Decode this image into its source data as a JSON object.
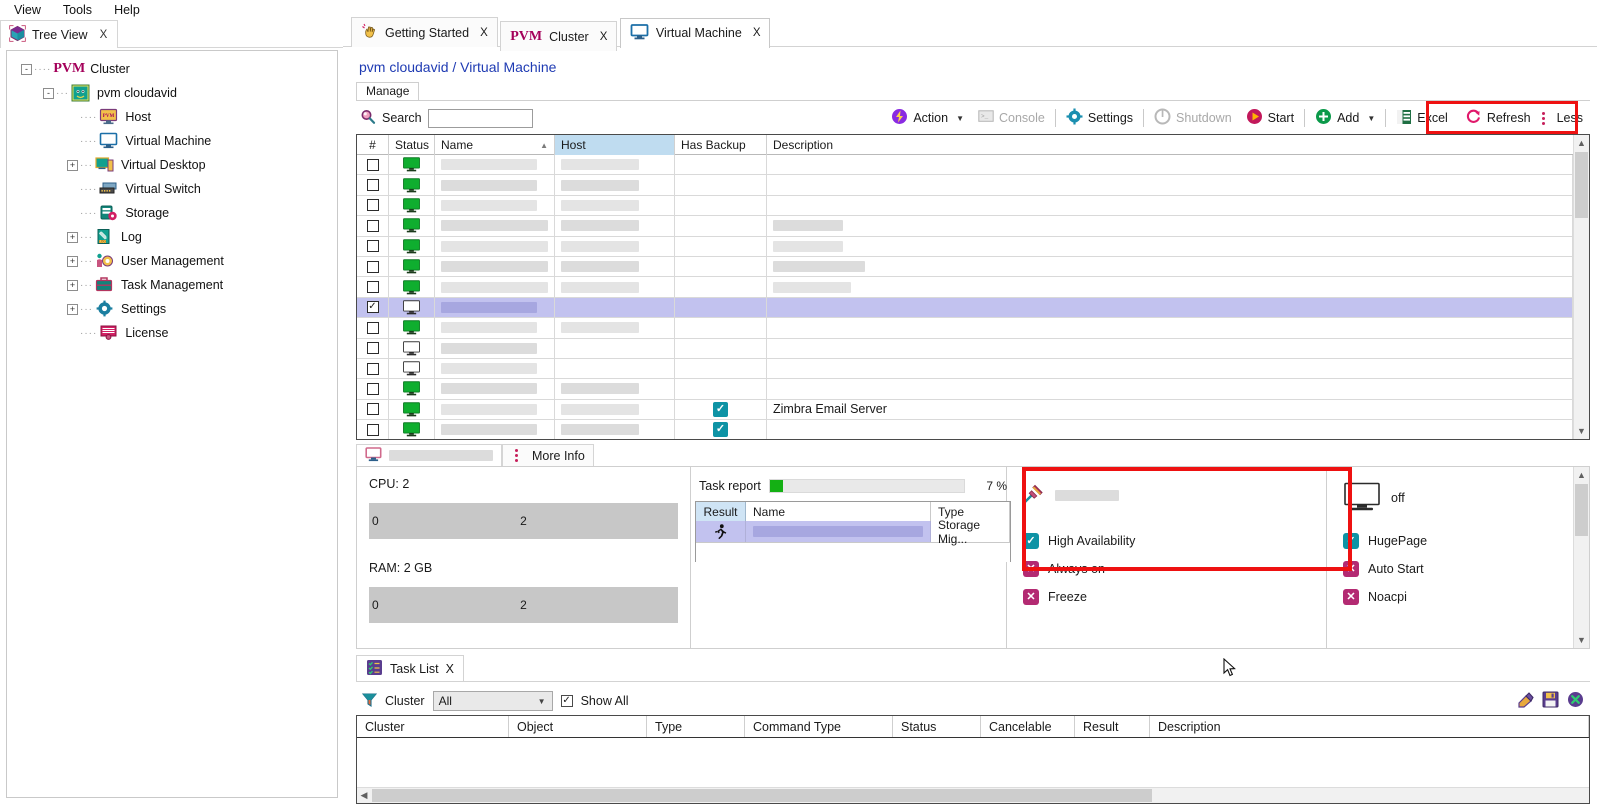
{
  "menubar": {
    "items": [
      "View",
      "Tools",
      "Help"
    ]
  },
  "left_tab": {
    "label": "Tree View",
    "close": "X",
    "icon": "cube-icon"
  },
  "tree": {
    "root": {
      "label": "Cluster",
      "brand": "PVM",
      "expander": "-"
    },
    "node": {
      "label": "pvm cloudavid",
      "expander": "-",
      "icon": "tiger-icon"
    },
    "children": [
      {
        "label": "Host",
        "expander": "none",
        "icon": "host-monitor-icon"
      },
      {
        "label": "Virtual Machine",
        "expander": "none",
        "icon": "monitor-icon"
      },
      {
        "label": "Virtual Desktop",
        "expander": "+",
        "icon": "desktop-icon"
      },
      {
        "label": "Virtual Switch",
        "expander": "none",
        "icon": "switch-icon"
      },
      {
        "label": "Storage",
        "expander": "none",
        "icon": "storage-icon"
      },
      {
        "label": "Log",
        "expander": "+",
        "icon": "log-icon"
      },
      {
        "label": "User Management",
        "expander": "+",
        "icon": "user-gear-icon"
      },
      {
        "label": "Task Management",
        "expander": "+",
        "icon": "briefcase-icon"
      },
      {
        "label": "Settings",
        "expander": "+",
        "icon": "gear-icon"
      },
      {
        "label": "License",
        "expander": "none",
        "icon": "license-icon"
      }
    ]
  },
  "top_tabs": [
    {
      "label": "Getting Started",
      "close": "X",
      "icon": "hand-wave-icon",
      "active": false
    },
    {
      "label": "Cluster",
      "close": "X",
      "icon": "pvm-logo-icon",
      "active": false
    },
    {
      "label": "Virtual Machine",
      "close": "X",
      "icon": "monitor-icon",
      "active": true
    }
  ],
  "breadcrumb": "pvm cloudavid / Virtual Machine",
  "manage_tab": "Manage",
  "search": {
    "label": "Search",
    "value": "",
    "placeholder": "",
    "icon": "search-icon"
  },
  "toolbar": {
    "buttons": [
      {
        "label": "Action",
        "icon": "action-icon",
        "caret": "▼",
        "disabled": false
      },
      {
        "label": "Console",
        "icon": "console-icon",
        "caret": "",
        "disabled": true
      },
      {
        "label": "Settings",
        "icon": "gear-icon",
        "caret": "",
        "disabled": false
      },
      {
        "label": "Shutdown",
        "icon": "power-icon",
        "caret": "",
        "disabled": true
      },
      {
        "label": "Start",
        "icon": "play-icon",
        "caret": "",
        "disabled": false
      },
      {
        "label": "Add",
        "icon": "plus-icon",
        "caret": "▼",
        "disabled": false
      },
      {
        "label": "Excel",
        "icon": "excel-icon",
        "caret": "",
        "disabled": false
      },
      {
        "label": "Refresh",
        "icon": "refresh-icon",
        "caret": "",
        "disabled": false
      },
      {
        "label": "Less",
        "icon": "vertical-dots-icon",
        "caret": "",
        "disabled": false
      }
    ],
    "highlight_color": "#ee1111"
  },
  "vm_grid": {
    "columns": [
      "#",
      "Status",
      "Name",
      "Host",
      "Has Backup",
      "Description"
    ],
    "sorted_column": "Name",
    "sort_direction": "asc",
    "selected_column": "Host",
    "rows": [
      {
        "checked": false,
        "status": "on",
        "name": "",
        "host": "",
        "has_backup": false,
        "description": ""
      },
      {
        "checked": false,
        "status": "on",
        "name": "",
        "host": "",
        "has_backup": false,
        "description": ""
      },
      {
        "checked": false,
        "status": "on",
        "name": "",
        "host": "",
        "has_backup": false,
        "description": ""
      },
      {
        "checked": false,
        "status": "on",
        "name": "",
        "host": "",
        "has_backup": false,
        "description": ""
      },
      {
        "checked": false,
        "status": "on",
        "name": "",
        "host": "",
        "has_backup": false,
        "description": ""
      },
      {
        "checked": false,
        "status": "on",
        "name": "",
        "host": "",
        "has_backup": false,
        "description": ""
      },
      {
        "checked": false,
        "status": "on",
        "name": "",
        "host": "",
        "has_backup": false,
        "description": ""
      },
      {
        "checked": true,
        "status": "off",
        "name": "",
        "host": "",
        "has_backup": false,
        "description": "",
        "selected": true
      },
      {
        "checked": false,
        "status": "on",
        "name": "",
        "host": "",
        "has_backup": false,
        "description": ""
      },
      {
        "checked": false,
        "status": "off",
        "name": "",
        "host": "",
        "has_backup": false,
        "description": ""
      },
      {
        "checked": false,
        "status": "off",
        "name": "",
        "host": "",
        "has_backup": false,
        "description": ""
      },
      {
        "checked": false,
        "status": "on",
        "name": "",
        "host": "",
        "has_backup": false,
        "description": ""
      },
      {
        "checked": false,
        "status": "on",
        "name": "",
        "host": "",
        "has_backup": true,
        "description": "Zimbra Email Server"
      },
      {
        "checked": false,
        "status": "on",
        "name": "",
        "host": "",
        "has_backup": true,
        "description": ""
      }
    ]
  },
  "details": {
    "tab_name": "",
    "more_info_label": "More Info",
    "cpu": {
      "label": "CPU: 2",
      "min": "0",
      "value": "2"
    },
    "ram": {
      "label": "RAM: 2 GB",
      "min": "0",
      "value": "2"
    },
    "task_report": {
      "label": "Task report",
      "percent_label": "7 %",
      "percent": 7,
      "columns": [
        "Result",
        "Name",
        "Type"
      ],
      "rows": [
        {
          "result_icon": "running-person-icon",
          "name": "",
          "type": "Storage Mig..."
        }
      ]
    },
    "power_state": "off",
    "pin_icon": "pin-icon",
    "flags": [
      {
        "label": "High Availability",
        "state": "on"
      },
      {
        "label": "HugePage",
        "state": "on"
      },
      {
        "label": "Always on",
        "state": "off"
      },
      {
        "label": "Auto Start",
        "state": "off"
      },
      {
        "label": "Freeze",
        "state": "off"
      },
      {
        "label": "Noacpi",
        "state": "off"
      }
    ]
  },
  "task_list": {
    "tab": {
      "label": "Task List",
      "close": "X",
      "icon": "tasklist-icon"
    },
    "filter": {
      "icon": "funnel-icon",
      "label": "Cluster",
      "selected": "All",
      "options": [
        "All"
      ],
      "show_all_label": "Show All",
      "show_all_checked": true
    },
    "icons": [
      "eraser-icon",
      "save-icon",
      "close-circle-icon"
    ],
    "columns": [
      "Cluster",
      "Object",
      "Type",
      "Command Type",
      "Status",
      "Cancelable",
      "Result",
      "Description"
    ],
    "rows": []
  },
  "colors": {
    "accent_red": "#ee1111",
    "teal": "#0e93a5",
    "magenta": "#b32a72",
    "green": "#14b014",
    "selection": "#c2c2ef",
    "header_blue": "#bfdcf0",
    "link_blue": "#1f3bb3"
  }
}
